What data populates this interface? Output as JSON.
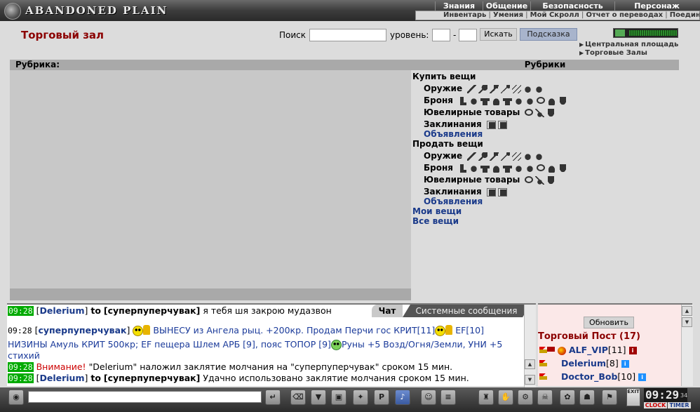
{
  "app": {
    "logo_text": "ABANDONED PLAIN"
  },
  "top_menu": {
    "main": [
      "Знания",
      "Общение",
      "Безопасность",
      "Персонаж"
    ],
    "sub": [
      "Инвентарь",
      "Умения",
      "Мой Скролл",
      "Отчет о переводах",
      "Поедин"
    ]
  },
  "header": {
    "title": "Торговый зал",
    "search_label": "Поиск",
    "level_label": "уровень:",
    "level_dash": "-",
    "search_button": "Искать",
    "hint_button": "Подсказка",
    "nav_links": [
      "Центральная площадь",
      "Торговые Залы"
    ]
  },
  "left_panel": {
    "header": "Рубрика:"
  },
  "right_panel": {
    "header": "Рубрики",
    "buy": {
      "title": "Купить вещи",
      "weapons": "Оружие",
      "armor": "Броня",
      "jewelry": "Ювелирные товары",
      "spells": "Заклинания",
      "ads": "Объявления"
    },
    "sell": {
      "title": "Продать вещи",
      "weapons": "Оружие",
      "armor": "Броня",
      "jewelry": "Ювелирные товары",
      "spells": "Заклинания",
      "ads": "Объявления"
    },
    "my_items": "Мои вещи",
    "all_items": "Все вещи",
    "icon_sets": {
      "weapons": [
        "sword-icon",
        "axe-icon",
        "hammer-icon",
        "spear-icon",
        "staff-icon",
        "glove-icon",
        "glove-icon"
      ],
      "armor": [
        "boot-icon",
        "glove-icon",
        "shirt-icon",
        "helm-icon",
        "shirt-icon",
        "glove-icon",
        "glove-icon",
        "ring-icon",
        "helm-icon",
        "shield-icon"
      ],
      "jewelry": [
        "ring-icon",
        "amulet-icon",
        "shield-icon"
      ],
      "spells": [
        "scroll-icon",
        "scroll-icon"
      ]
    }
  },
  "chat": {
    "tabs": {
      "chat": "Чат",
      "system": "Системные сообщения"
    },
    "lines": [
      {
        "time": "09:28",
        "nick": "Delerium",
        "to_word": "to",
        "target": "суперпуперчувак",
        "text": "я тебя шя закрою мудазвон"
      },
      {
        "time": "09:28",
        "nick": "суперпуперчувак",
        "text1": "ВЫНЕСУ из Ангела рыц. +200кр. Продам Перчи гос КРИТ[11]",
        "text2": "EF[10]",
        "text3": "НИЗИНЫ Амуль КРИТ 500кр; EF пещера Шлем АРБ [9], пояс ТОПОР [9]",
        "text4": "Руны +5 Возд/Огня/Земли, УНИ +5",
        "text5": "стихий"
      },
      {
        "time": "09:28",
        "warn": "Внимание!",
        "text": "\"Delerium\" наложил заклятие молчания на \"суперпуперчувак\" сроком 15 мин."
      },
      {
        "time": "09:28",
        "nick": "Delerium",
        "to_word": "to",
        "target": "суперпуперчувак",
        "text": "Удачно использовано заклятие молчания сроком 15 мин."
      }
    ]
  },
  "online": {
    "refresh_button": "Обновить",
    "room_title": "Торговый Пост (17)",
    "users": [
      {
        "name": "ALF_VIP",
        "level": "[11]"
      },
      {
        "name": "Delerium",
        "level": "[8]"
      },
      {
        "name": "Doctor_Bob",
        "level": "[10]"
      }
    ]
  },
  "toolbar": {
    "exit_label": "EXIT",
    "clock": "09:29",
    "clock_sec": "34",
    "clock_tab": "CLOCK",
    "timer_tab": "TIMER"
  },
  "colors": {
    "title_red": "#8b0000",
    "link_blue": "#1a3a8a",
    "timestamp_green": "#00aa00"
  }
}
